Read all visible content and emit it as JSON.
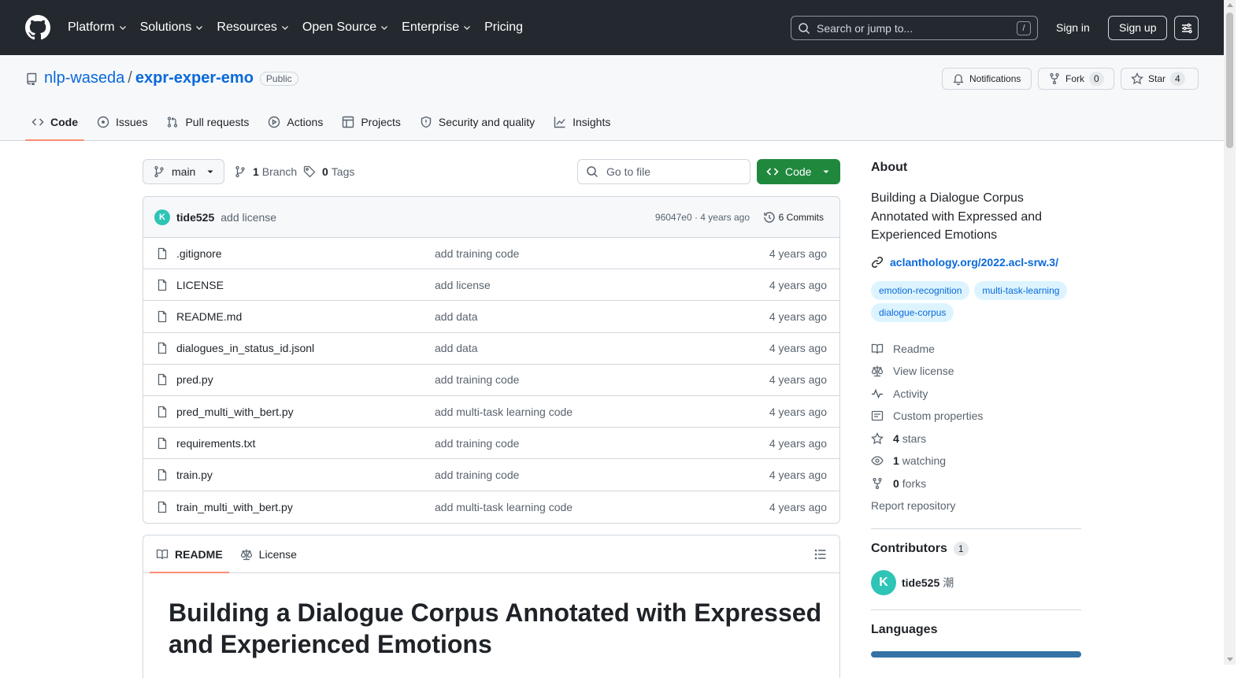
{
  "topnav": {
    "items": [
      {
        "label": "Platform",
        "dropdown": true
      },
      {
        "label": "Solutions",
        "dropdown": true
      },
      {
        "label": "Resources",
        "dropdown": true
      },
      {
        "label": "Open Source",
        "dropdown": true
      },
      {
        "label": "Enterprise",
        "dropdown": true
      },
      {
        "label": "Pricing",
        "dropdown": false
      }
    ],
    "search_placeholder": "Search or jump to...",
    "search_shortcut": "/",
    "signin": "Sign in",
    "signup": "Sign up"
  },
  "repo": {
    "owner": "nlp-waseda",
    "separator": "/",
    "name": "expr-exper-emo",
    "visibility": "Public",
    "notifications_label": "Notifications",
    "fork_label": "Fork",
    "fork_count": "0",
    "star_label": "Star",
    "star_count": "4"
  },
  "reponav": {
    "tabs": [
      {
        "label": "Code",
        "icon": "code-icon"
      },
      {
        "label": "Issues",
        "icon": "issue-icon"
      },
      {
        "label": "Pull requests",
        "icon": "pull-request-icon"
      },
      {
        "label": "Actions",
        "icon": "play-icon"
      },
      {
        "label": "Projects",
        "icon": "table-icon"
      },
      {
        "label": "Security and quality",
        "icon": "shield-icon"
      },
      {
        "label": "Insights",
        "icon": "graph-icon"
      }
    ]
  },
  "branchbar": {
    "branch": "main",
    "branch_count": "1",
    "branch_label": "Branch",
    "tag_count": "0",
    "tag_label": "Tags",
    "goto_placeholder": "Go to file",
    "code_button": "Code"
  },
  "commit": {
    "author": "tide525",
    "message": "add license",
    "sha_time": "96047e0 · 4 years ago",
    "commits_label": "6 Commits"
  },
  "files": [
    {
      "name": ".gitignore",
      "message": "add training code",
      "date": "4 years ago"
    },
    {
      "name": "LICENSE",
      "message": "add license",
      "date": "4 years ago"
    },
    {
      "name": "README.md",
      "message": "add data",
      "date": "4 years ago"
    },
    {
      "name": "dialogues_in_status_id.jsonl",
      "message": "add data",
      "date": "4 years ago"
    },
    {
      "name": "pred.py",
      "message": "add training code",
      "date": "4 years ago"
    },
    {
      "name": "pred_multi_with_bert.py",
      "message": "add multi-task learning code",
      "date": "4 years ago"
    },
    {
      "name": "requirements.txt",
      "message": "add training code",
      "date": "4 years ago"
    },
    {
      "name": "train.py",
      "message": "add training code",
      "date": "4 years ago"
    },
    {
      "name": "train_multi_with_bert.py",
      "message": "add multi-task learning code",
      "date": "4 years ago"
    }
  ],
  "readme": {
    "tab_readme": "README",
    "tab_license": "License",
    "heading": "Building a Dialogue Corpus Annotated with Expressed and Experienced Emotions"
  },
  "about": {
    "title": "About",
    "description": "Building a Dialogue Corpus Annotated with Expressed and Experienced Emotions",
    "homepage": "aclanthology.org/2022.acl-srw.3/",
    "topics": [
      "emotion-recognition",
      "multi-task-learning",
      "dialogue-corpus"
    ],
    "items": [
      {
        "icon": "book-icon",
        "count": "",
        "label": "Readme"
      },
      {
        "icon": "law-icon",
        "count": "",
        "label": "View license"
      },
      {
        "icon": "pulse-icon",
        "count": "",
        "label": "Activity"
      },
      {
        "icon": "note-icon",
        "count": "",
        "label": "Custom properties"
      },
      {
        "icon": "star-icon",
        "count": "4",
        "label": "stars"
      },
      {
        "icon": "eye-icon",
        "count": "1",
        "label": "watching"
      },
      {
        "icon": "fork-icon",
        "count": "0",
        "label": "forks"
      }
    ],
    "report": "Report repository"
  },
  "contributors": {
    "title": "Contributors",
    "count": "1",
    "list": [
      {
        "login": "tide525",
        "name": "潮"
      }
    ]
  },
  "languages": {
    "title": "Languages",
    "bar_color": "#3572A5"
  },
  "colors": {
    "header_bg": "#24292f",
    "link": "#0969da",
    "primary_button": "#1f883d",
    "tab_underline": "#fd8c73"
  }
}
